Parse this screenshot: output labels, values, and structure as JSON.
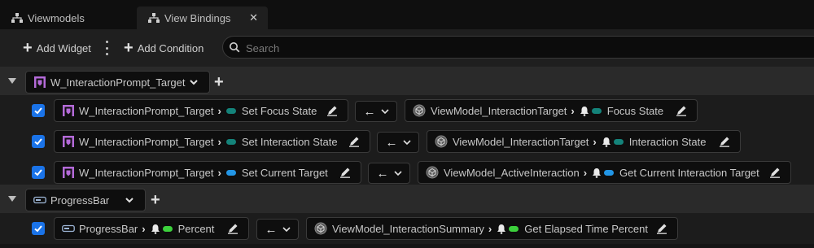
{
  "tabs": [
    {
      "label": "Viewmodels",
      "icon": "hierarchy-icon"
    },
    {
      "label": "View Bindings",
      "icon": "hierarchy-icon",
      "close": "✕"
    }
  ],
  "toolbar": {
    "add_widget_label": "Add Widget",
    "add_condition_label": "Add Condition",
    "search_placeholder": "Search"
  },
  "groups": [
    {
      "widget": "W_InteractionPrompt_Target",
      "widget_icon": "widget-blueprint-icon"
    },
    {
      "widget": "ProgressBar",
      "widget_icon": "progress-bar-icon"
    }
  ],
  "bindings": [
    {
      "checked": true,
      "widget": "W_InteractionPrompt_Target",
      "widget_property": "Set Focus State",
      "widget_dot_color": "#14837a",
      "widget_bell": false,
      "mode": "←",
      "viewmodel": "ViewModel_InteractionTarget",
      "vm_property": "Focus State",
      "vm_bell": true,
      "vm_dot_color": "#14837a"
    },
    {
      "checked": true,
      "widget": "W_InteractionPrompt_Target",
      "widget_property": "Set Interaction State",
      "widget_dot_color": "#14837a",
      "widget_bell": false,
      "mode": "←",
      "viewmodel": "ViewModel_InteractionTarget",
      "vm_property": "Interaction State",
      "vm_bell": true,
      "vm_dot_color": "#14837a"
    },
    {
      "checked": true,
      "widget": "W_InteractionPrompt_Target",
      "widget_property": "Set Current Target",
      "widget_dot_color": "#2296e6",
      "widget_bell": false,
      "mode": "←",
      "viewmodel": "ViewModel_ActiveInteraction",
      "vm_property": "Get Current Interaction Target",
      "vm_bell": true,
      "vm_dot_color": "#2296e6"
    },
    {
      "checked": true,
      "widget": "ProgressBar",
      "widget_property": "Percent",
      "widget_dot_color": "#3cd13c",
      "widget_bell": true,
      "mode": "←",
      "viewmodel": "ViewModel_InteractionSummary",
      "vm_property": "Get Elapsed Time Percent",
      "vm_bell": true,
      "vm_dot_color": "#3cd13c"
    }
  ]
}
